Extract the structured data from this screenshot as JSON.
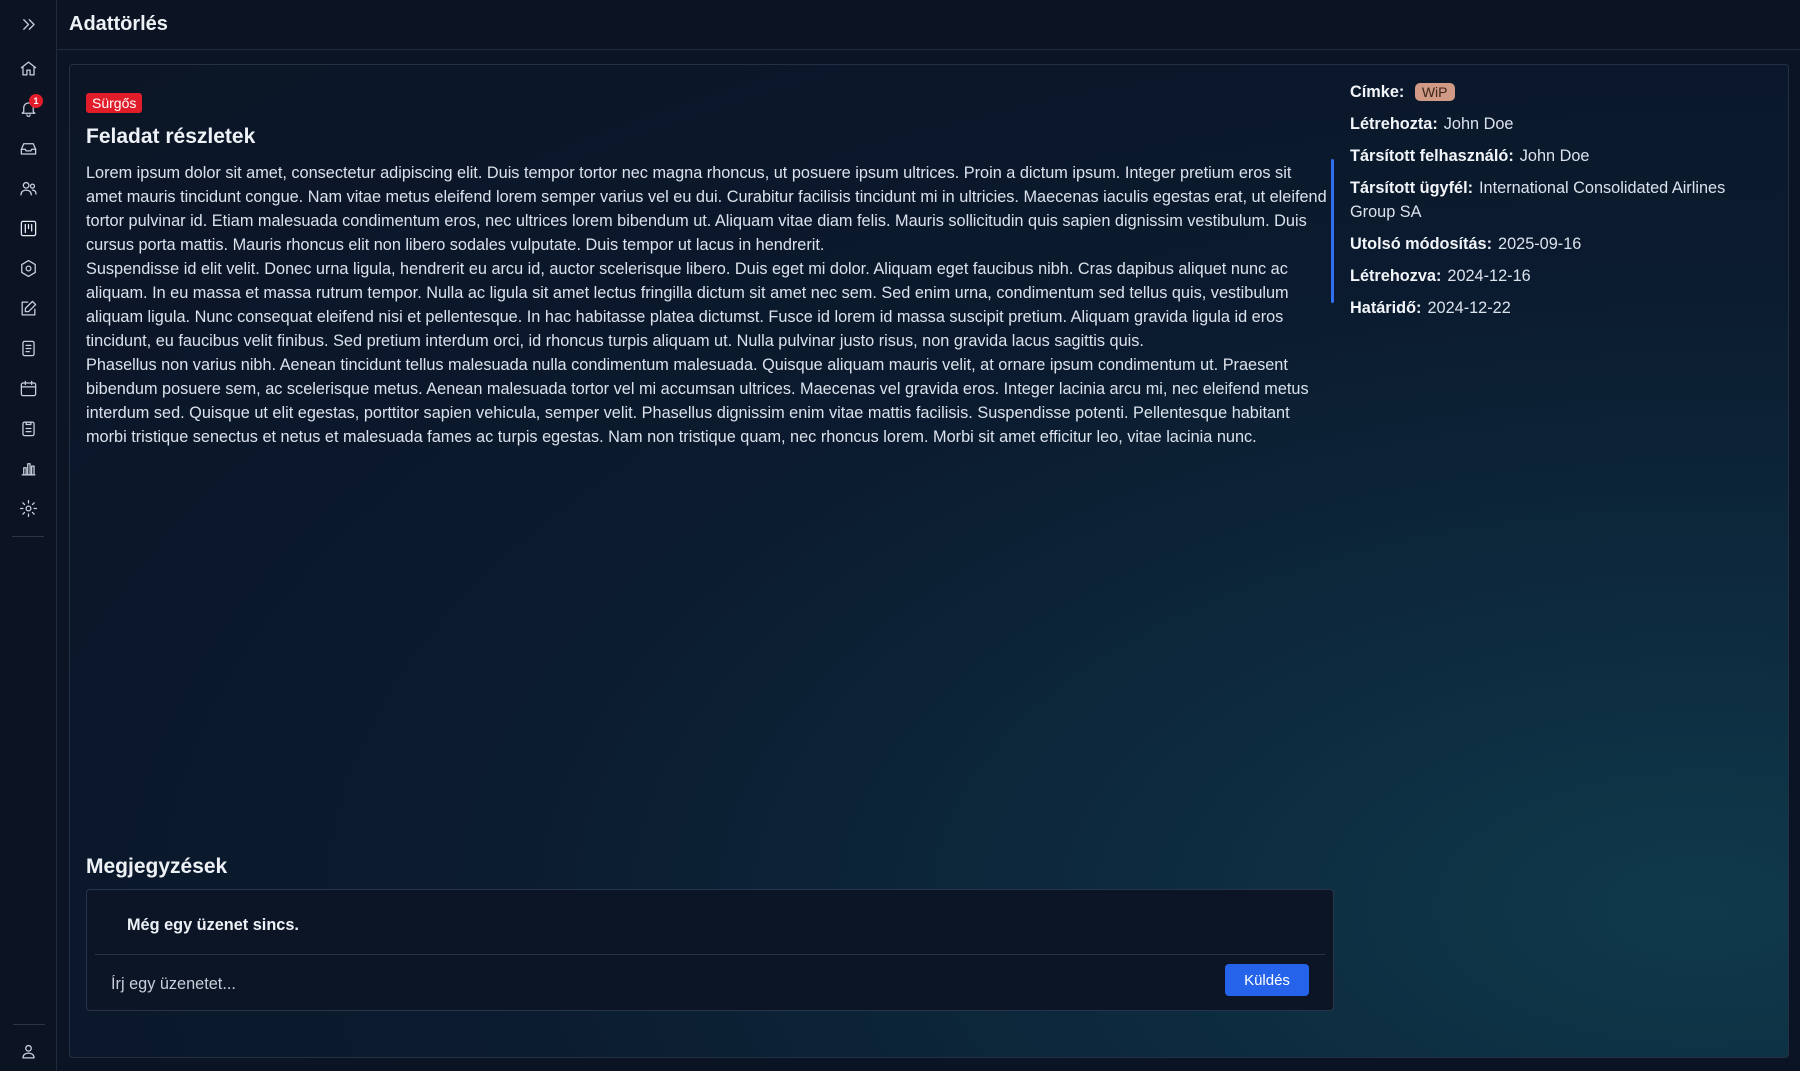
{
  "page_title": "Adattörlés",
  "sidebar": {
    "notification_count": "1"
  },
  "task": {
    "priority_badge": "Sürgős",
    "title": "Feladat részletek",
    "description": [
      "Lorem ipsum dolor sit amet, consectetur adipiscing elit. Duis tempor tortor nec magna rhoncus, ut posuere ipsum ultrices. Proin a dictum ipsum. Integer pretium eros sit amet mauris tincidunt congue. Nam vitae metus eleifend lorem semper varius vel eu dui. Curabitur facilisis tincidunt mi in ultricies. Maecenas iaculis egestas erat, ut eleifend tortor pulvinar id. Etiam malesuada condimentum eros, nec ultrices lorem bibendum ut. Aliquam vitae diam felis. Mauris sollicitudin quis sapien dignissim vestibulum. Duis cursus porta mattis. Mauris rhoncus elit non libero sodales vulputate. Duis tempor ut lacus in hendrerit.",
      "Suspendisse id elit velit. Donec urna ligula, hendrerit eu arcu id, auctor scelerisque libero. Duis eget mi dolor. Aliquam eget faucibus nibh. Cras dapibus aliquet nunc ac aliquam. In eu massa et massa rutrum tempor. Nulla ac ligula sit amet lectus fringilla dictum sit amet nec sem. Sed enim urna, condimentum sed tellus quis, vestibulum aliquam ligula. Nunc consequat eleifend nisi et pellentesque. In hac habitasse platea dictumst. Fusce id lorem id massa suscipit pretium. Aliquam gravida ligula id eros tincidunt, eu faucibus velit finibus. Sed pretium interdum orci, id rhoncus turpis aliquam ut. Nulla pulvinar justo risus, non gravida lacus sagittis quis.",
      "Phasellus non varius nibh. Aenean tincidunt tellus malesuada nulla condimentum malesuada. Quisque aliquam mauris velit, at ornare ipsum condimentum ut. Praesent bibendum posuere sem, ac scelerisque metus. Aenean malesuada tortor vel mi accumsan ultrices. Maecenas vel gravida eros. Integer lacinia arcu mi, nec eleifend metus interdum sed. Quisque ut elit egestas, porttitor sapien vehicula, semper velit. Phasellus dignissim enim vitae mattis facilisis. Suspendisse potenti. Pellentesque habitant morbi tristique senectus et netus et malesuada fames ac turpis egestas. Nam non tristique quam, nec rhoncus lorem. Morbi sit amet efficitur leo, vitae lacinia nunc."
    ]
  },
  "meta": {
    "tag_label": "Címke:",
    "tag_value": "WiP",
    "created_by_label": "Létrehozta:",
    "created_by_value": "John Doe",
    "assigned_user_label": "Társított felhasználó:",
    "assigned_user_value": "John Doe",
    "assigned_client_label": "Társított ügyfél:",
    "assigned_client_value": "International Consolidated Airlines Group SA",
    "last_modified_label": "Utolsó módosítás:",
    "last_modified_value": "2025-09-16",
    "created_label": "Létrehozva:",
    "created_value": "2024-12-16",
    "deadline_label": "Határidő:",
    "deadline_value": "2024-12-22"
  },
  "notes": {
    "title": "Megjegyzések",
    "empty_message": "Még egy üzenet sincs.",
    "input_placeholder": "Írj egy üzenetet...",
    "send_label": "Küldés"
  },
  "colors": {
    "accent": "#2563eb",
    "urgent": "#e11d2a",
    "wip_tag": "#d09a86"
  }
}
